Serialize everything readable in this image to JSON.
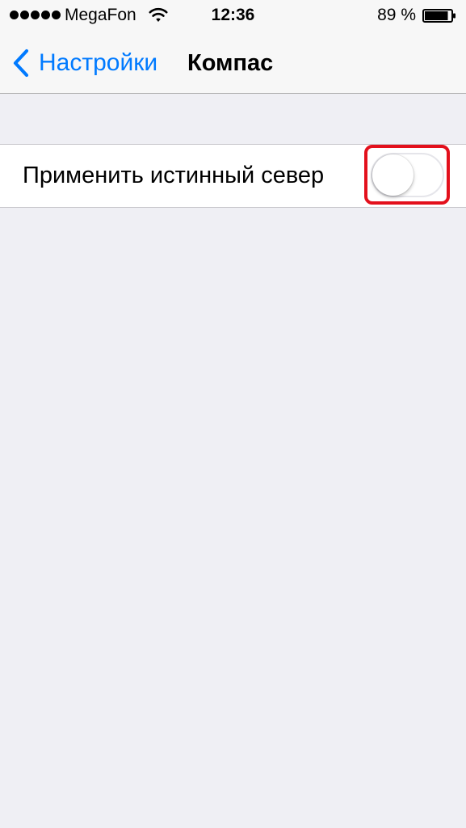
{
  "status_bar": {
    "carrier": "MegaFon",
    "time": "12:36",
    "battery_percent": "89 %",
    "signal_bars": 5,
    "battery_level": 0.89
  },
  "nav": {
    "back_label": "Настройки",
    "title": "Компас"
  },
  "settings": {
    "true_north_label": "Применить истинный север",
    "true_north_enabled": false
  },
  "colors": {
    "accent": "#007aff",
    "highlight": "#e3101c",
    "background": "#efeff4"
  }
}
